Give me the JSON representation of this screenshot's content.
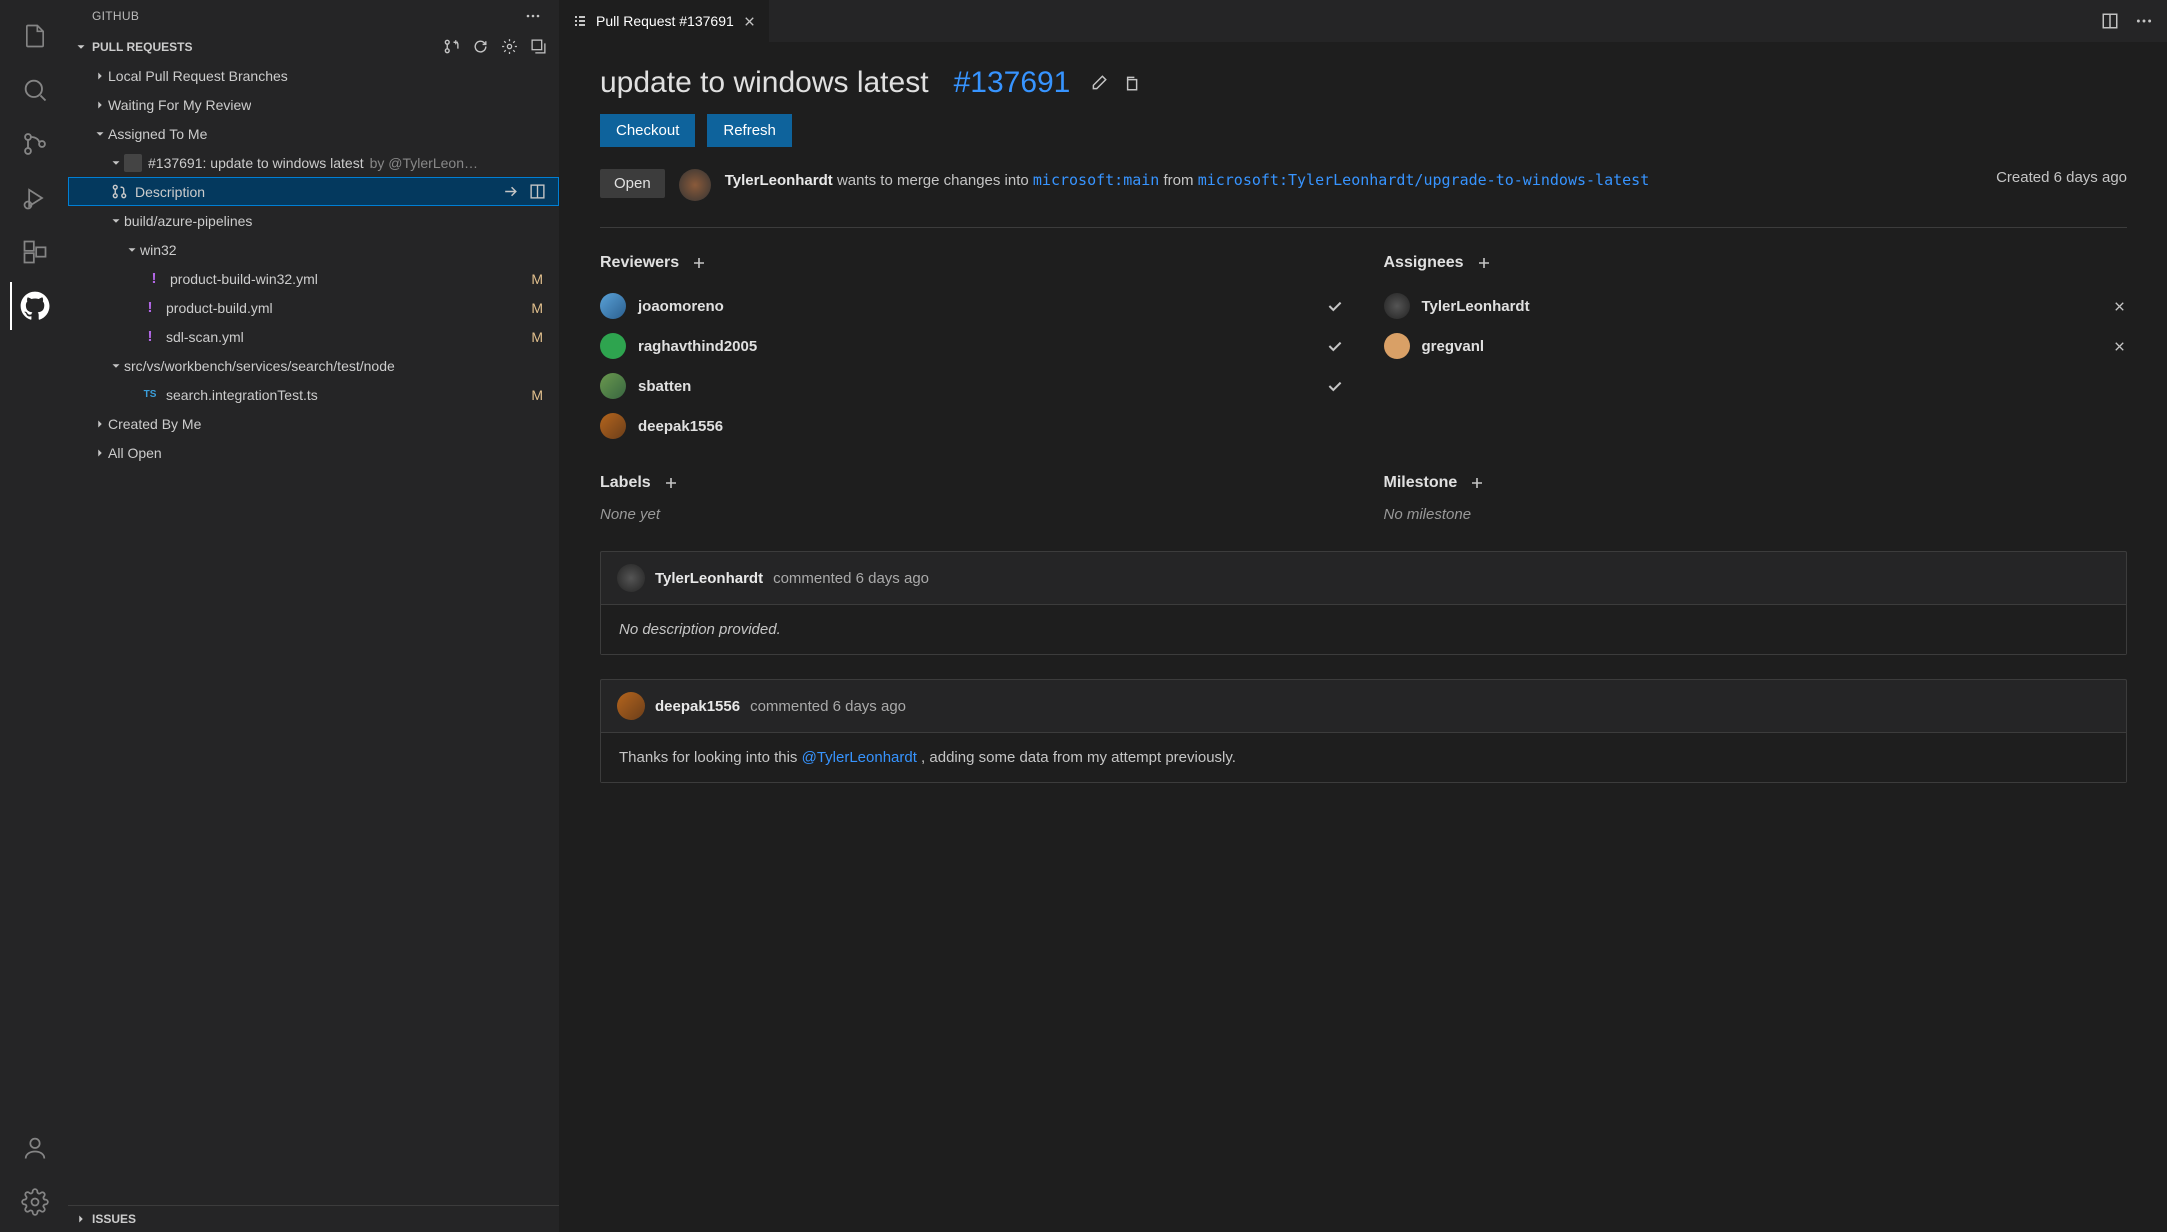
{
  "sidebar": {
    "title": "GITHUB",
    "sections": {
      "pull_requests": "PULL REQUESTS",
      "issues": "ISSUES"
    },
    "groups": {
      "local": "Local Pull Request Branches",
      "waiting": "Waiting For My Review",
      "assigned": "Assigned To Me",
      "created": "Created By Me",
      "all_open": "All Open"
    },
    "pr_item": {
      "label": "#137691: update to windows latest",
      "author": "by @TylerLeon…"
    },
    "description": "Description",
    "folders": {
      "build": "build/azure-pipelines",
      "win32": "win32",
      "src": "src/vs/workbench/services/search/test/node"
    },
    "files": {
      "f1": "product-build-win32.yml",
      "f2": "product-build.yml",
      "f3": "sdl-scan.yml",
      "f4": "search.integrationTest.ts"
    },
    "mod": "M"
  },
  "tab": {
    "title": "Pull Request #137691"
  },
  "pr": {
    "title": "update to windows latest",
    "number": "#137691",
    "checkout": "Checkout",
    "refresh": "Refresh",
    "status": "Open",
    "author": "TylerLeonhardt",
    "merge_text1": " wants to merge changes into ",
    "base_branch": "microsoft:main",
    "merge_text2": " from ",
    "head_branch": "microsoft:TylerLeonhardt/upgrade-to-windows-latest",
    "created": "Created 6 days ago",
    "headings": {
      "reviewers": "Reviewers",
      "assignees": "Assignees",
      "labels": "Labels",
      "milestone": "Milestone"
    },
    "reviewers": [
      {
        "name": "joaomoreno",
        "status": "check"
      },
      {
        "name": "raghavthind2005",
        "status": "check"
      },
      {
        "name": "sbatten",
        "status": "check"
      },
      {
        "name": "deepak1556",
        "status": "dot"
      }
    ],
    "assignees": [
      {
        "name": "TylerLeonhardt"
      },
      {
        "name": "gregvanl"
      }
    ],
    "labels_empty": "None yet",
    "milestone_empty": "No milestone",
    "comments": [
      {
        "author": "TylerLeonhardt",
        "when": "commented 6 days ago",
        "body": "No description provided.",
        "italic": true
      },
      {
        "author": "deepak1556",
        "when": "commented 6 days ago",
        "body_prefix": "Thanks for looking into this ",
        "mention": "@TylerLeonhardt",
        "body_suffix": " , adding some data from my attempt previously."
      }
    ]
  }
}
